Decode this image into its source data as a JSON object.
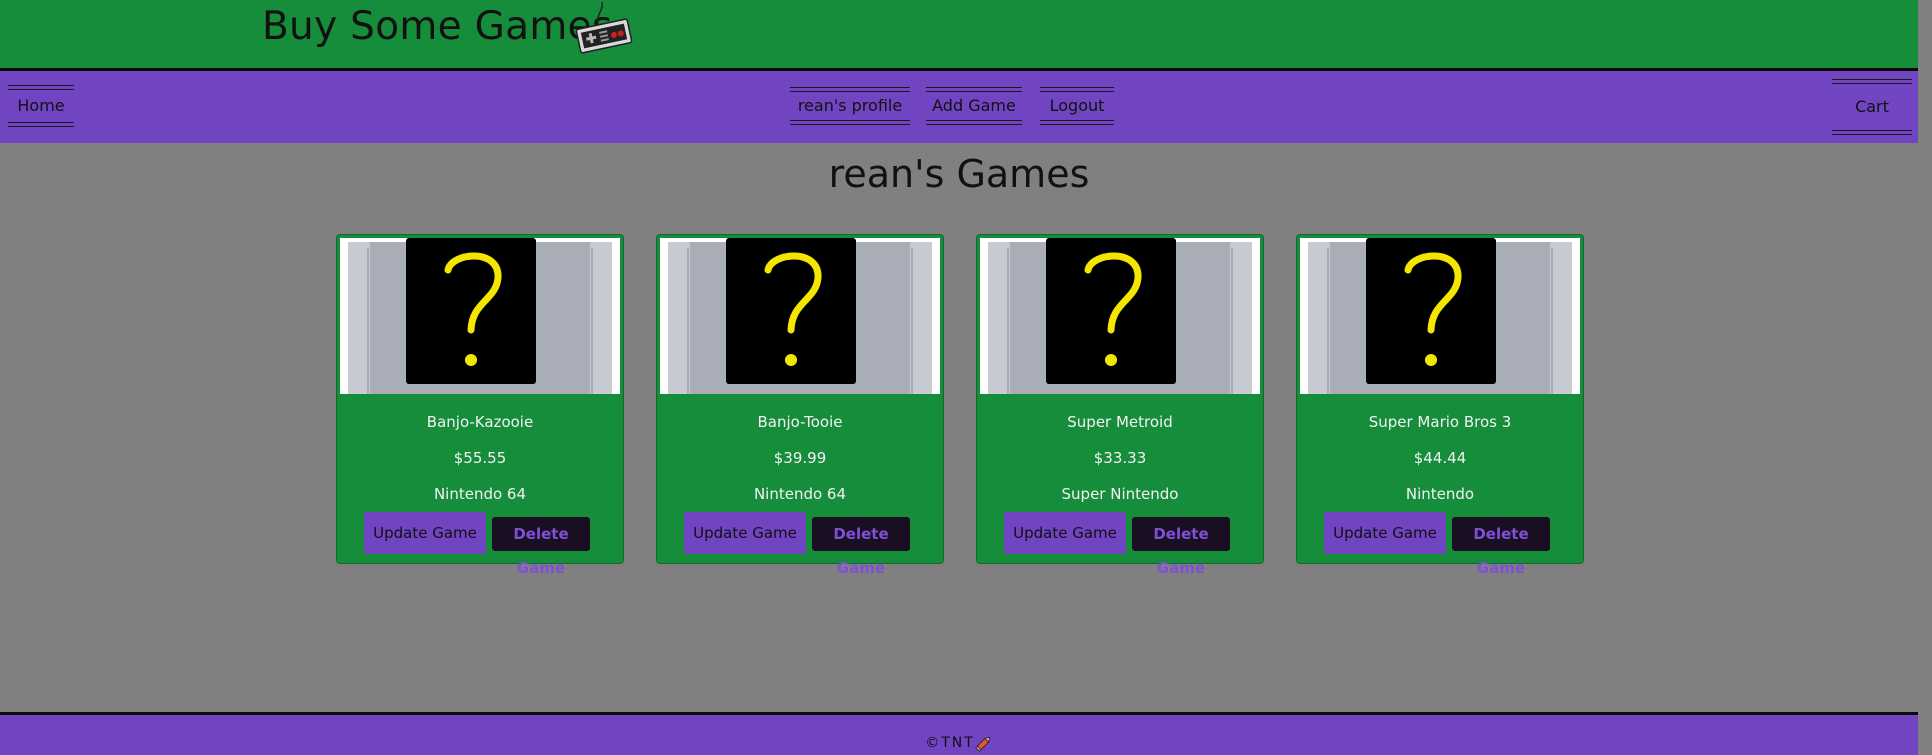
{
  "header": {
    "title": "Buy Some Games",
    "logo_icon": "nes-controller-icon",
    "background": "#158d3a"
  },
  "navbar": {
    "home": "Home",
    "profile": "rean's profile",
    "add_game": "Add Game",
    "logout": "Logout",
    "cart": "Cart",
    "background": "#7144c2"
  },
  "main": {
    "heading": "rean's Games",
    "games": [
      {
        "name": "Banjo-Kazooie",
        "price": "$55.55",
        "platform": "Nintendo 64",
        "update_label": "Update Game",
        "delete_label": "Delete Game",
        "image_icon": "question-mark-cartridge-icon"
      },
      {
        "name": "Banjo-Tooie",
        "price": "$39.99",
        "platform": "Nintendo 64",
        "update_label": "Update Game",
        "delete_label": "Delete Game",
        "image_icon": "question-mark-cartridge-icon"
      },
      {
        "name": "Super Metroid",
        "price": "$33.33",
        "platform": "Super Nintendo",
        "update_label": "Update Game",
        "delete_label": "Delete Game",
        "image_icon": "question-mark-cartridge-icon"
      },
      {
        "name": "Super Mario Bros 3",
        "price": "$44.44",
        "platform": "Nintendo",
        "update_label": "Update Game",
        "delete_label": "Delete Game",
        "image_icon": "question-mark-cartridge-icon"
      }
    ]
  },
  "footer": {
    "text": "©TNT",
    "icon": "pencil-icon"
  },
  "colors": {
    "green": "#158d3a",
    "purple": "#7144c2",
    "gray": "#808080",
    "question_yellow": "#f5e600"
  }
}
